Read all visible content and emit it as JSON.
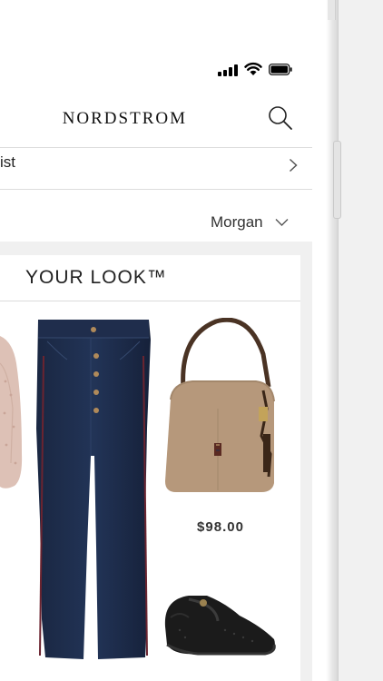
{
  "header": {
    "brand": "NORDSTROM"
  },
  "list_row": {
    "label": "ist"
  },
  "user": {
    "name": "Morgan"
  },
  "look": {
    "title": "YOUR LOOK™",
    "bag_price": "$98.00"
  },
  "icons": [
    "signal-icon",
    "wifi-icon",
    "battery-icon",
    "search-icon",
    "chevron-right-icon",
    "chevron-down-icon"
  ]
}
